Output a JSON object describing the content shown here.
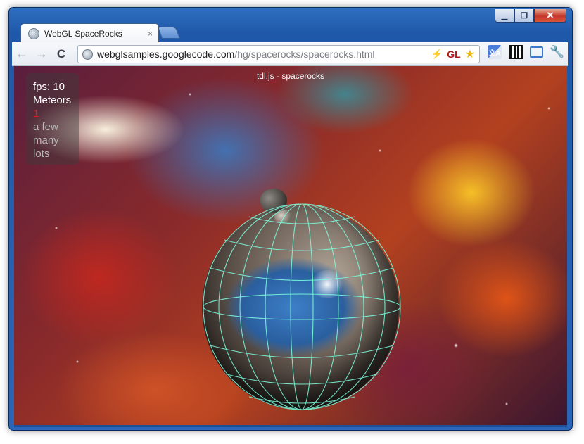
{
  "window": {
    "controls": {
      "minimize": "▁",
      "maximize": "❐",
      "close": "✕"
    }
  },
  "tab": {
    "title": "WebGL SpaceRocks",
    "close": "×",
    "icon": "globe-icon"
  },
  "toolbar": {
    "back": "←",
    "forward": "→",
    "reload": "C",
    "url_host": "webglsamples.googlecode.com",
    "url_path": "/hg/spacerocks/spacerocks.html",
    "lightning": "⚡",
    "gl_badge": "GL",
    "star": "★",
    "translate": "文A",
    "wrench": "🔧"
  },
  "page": {
    "caption_link": "tdl.js",
    "caption_rest": " - spacerocks",
    "hud": {
      "fps": "fps: 10",
      "meteors_label": "Meteors",
      "options": [
        "1",
        "a few",
        "many",
        "lots"
      ],
      "selected_index": 0
    }
  },
  "colors": {
    "selected_option": "#d41d1d",
    "wireframe": "#7fffe0",
    "window_frame": "#2a66b8"
  }
}
